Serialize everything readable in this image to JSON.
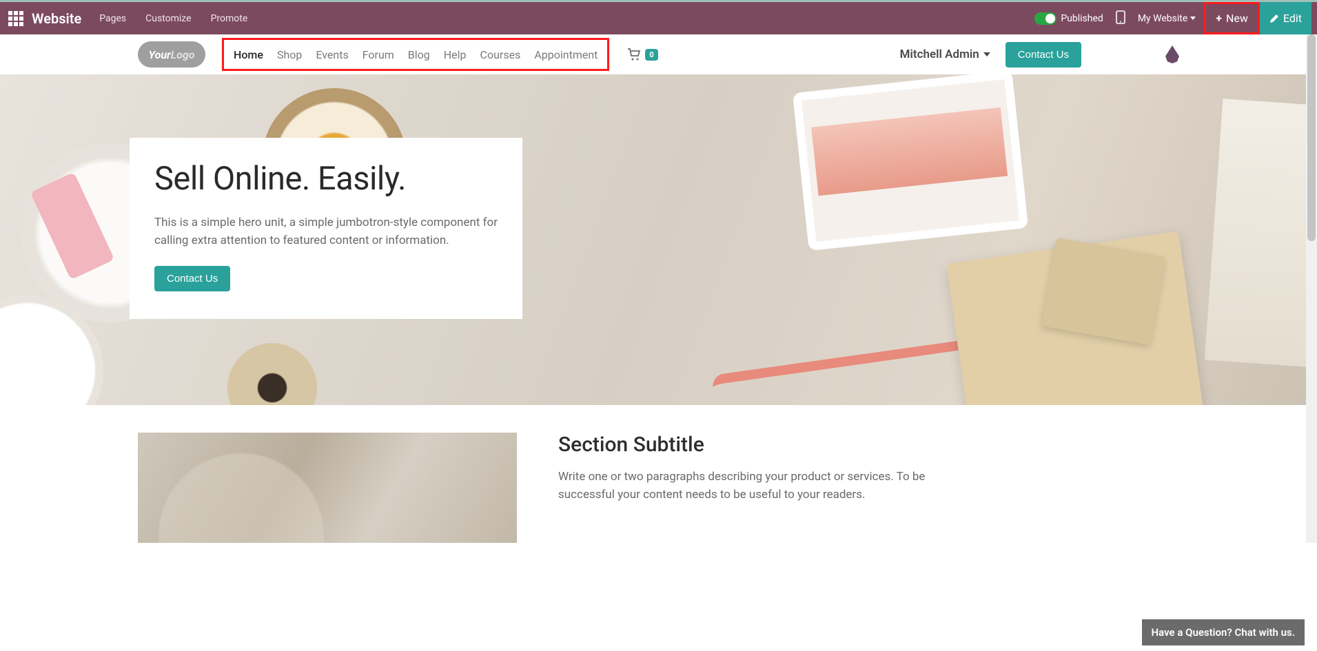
{
  "topbar": {
    "brand": "Website",
    "menu": [
      "Pages",
      "Customize",
      "Promote"
    ],
    "published": "Published",
    "my_website": "My Website",
    "new": "New",
    "edit": "Edit"
  },
  "site_nav": {
    "logo_your": "Your",
    "logo_logo": "Logo",
    "items": [
      {
        "label": "Home",
        "active": true
      },
      {
        "label": "Shop",
        "active": false
      },
      {
        "label": "Events",
        "active": false
      },
      {
        "label": "Forum",
        "active": false
      },
      {
        "label": "Blog",
        "active": false
      },
      {
        "label": "Help",
        "active": false
      },
      {
        "label": "Courses",
        "active": false
      },
      {
        "label": "Appointment",
        "active": false
      }
    ],
    "cart_count": "0",
    "user": "Mitchell Admin",
    "contact": "Contact Us"
  },
  "hero": {
    "title": "Sell Online. Easily.",
    "subtitle": "This is a simple hero unit, a simple jumbotron-style component for calling extra attention to featured content or information.",
    "cta": "Contact Us"
  },
  "section": {
    "title": "Section Subtitle",
    "body": "Write one or two paragraphs describing your product or services. To be successful your content needs to be useful to your readers."
  },
  "chat": {
    "label": "Have a Question? Chat with us."
  }
}
